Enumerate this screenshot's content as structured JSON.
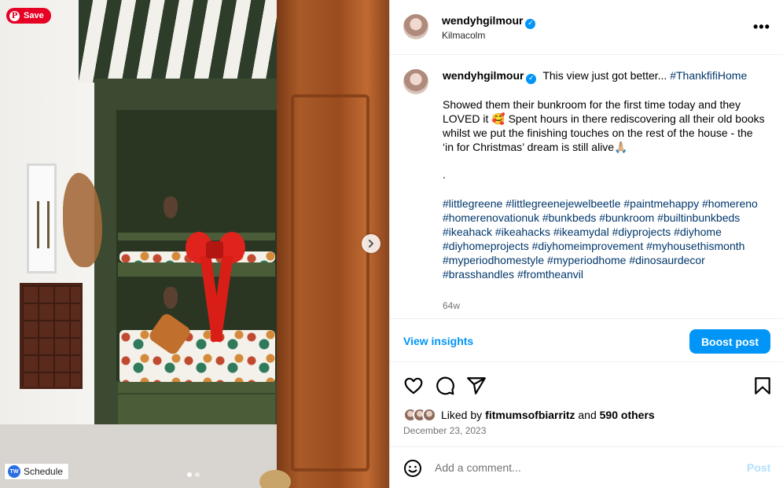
{
  "image_overlay": {
    "save_label": "Save",
    "pinterest_glyph": "P",
    "schedule_label": "Schedule",
    "schedule_glyph": "TW",
    "carousel_dots": [
      true,
      false
    ]
  },
  "header": {
    "username": "wendyhgilmour",
    "verified_glyph": "✓",
    "location": "Kilmacolm",
    "more_glyph": "•••"
  },
  "caption": {
    "username": "wendyhgilmour",
    "headline": "This view just got better... ",
    "headline_tag": "#ThankfifiHome",
    "body": "Showed them their bunkroom for the first time today and they LOVED it 🥰 Spent hours in there rediscovering all their old books whilst we put the finishing touches on the rest of the house - the ‘in for Christmas’ dream is still alive🙏🏼",
    "separator": ".",
    "hashtags": "#littlegreene #littlegreenejewelbeetle #paintmehappy #homereno #homerenovationuk #bunkbeds #bunkroom #builtinbunkbeds #ikeahack #ikeahacks #ikeamydal #diyprojects #diyhome #diyhomeprojects #diyhomeimprovement #myhousethismonth #myperiodhomestyle #myperiodhome #dinosaurdecor #brasshandles #fromtheanvil",
    "time_ago": "64w"
  },
  "insights": {
    "view_label": "View insights",
    "boost_label": "Boost post"
  },
  "likes": {
    "prefix": "Liked by ",
    "liker": "fitmumsofbiarritz",
    "joiner": " and ",
    "others": "590 others"
  },
  "date": "December 23, 2023",
  "comment": {
    "placeholder": "Add a comment...",
    "post_label": "Post"
  },
  "colors": {
    "accent": "#0095f6",
    "pinterest": "#e60023",
    "hashtag": "#00376b"
  }
}
